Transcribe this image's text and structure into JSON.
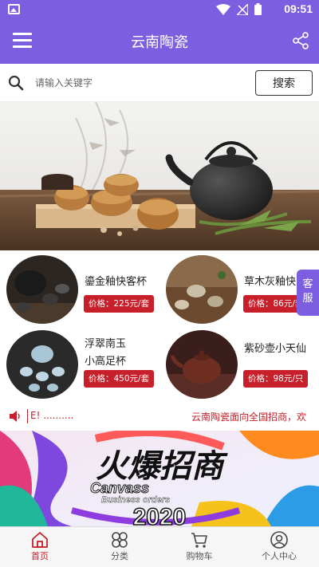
{
  "status_bar": {
    "time": "09:51"
  },
  "header": {
    "title": "云南陶瓷"
  },
  "search": {
    "placeholder": "请输入关键字",
    "button_label": "搜索"
  },
  "products": [
    {
      "name_line1": "鎏金釉快客杯",
      "name_line2": "",
      "price": "价格：225元/套"
    },
    {
      "name_line1": "草木灰釉快",
      "name_line2": "",
      "price": "价格：86元/套"
    },
    {
      "name_line1": "浮翠南玉",
      "name_line2": "小高足杯",
      "price": "价格：450元/套"
    },
    {
      "name_line1": "紫砂壶小天仙",
      "name_line2": "",
      "price": "价格：98元/只"
    }
  ],
  "service_float": {
    "line1": "客",
    "line2": "服"
  },
  "notice": {
    "left_text": "E! ..........",
    "right_text": "云南陶瓷面向全国招商，欢"
  },
  "promo": {
    "headline": "火爆招商",
    "subline1": "Canvass",
    "subline2": "Business orders",
    "year": "2020"
  },
  "bottom_nav": [
    {
      "label": "首页",
      "icon": "home-icon",
      "active": true
    },
    {
      "label": "分类",
      "icon": "category-icon",
      "active": false
    },
    {
      "label": "购物车",
      "icon": "cart-icon",
      "active": false
    },
    {
      "label": "个人中心",
      "icon": "user-icon",
      "active": false
    }
  ],
  "colors": {
    "primary": "#7b5fe0",
    "accent_red": "#c8202a",
    "nav_bg": "#f6f6f6"
  }
}
